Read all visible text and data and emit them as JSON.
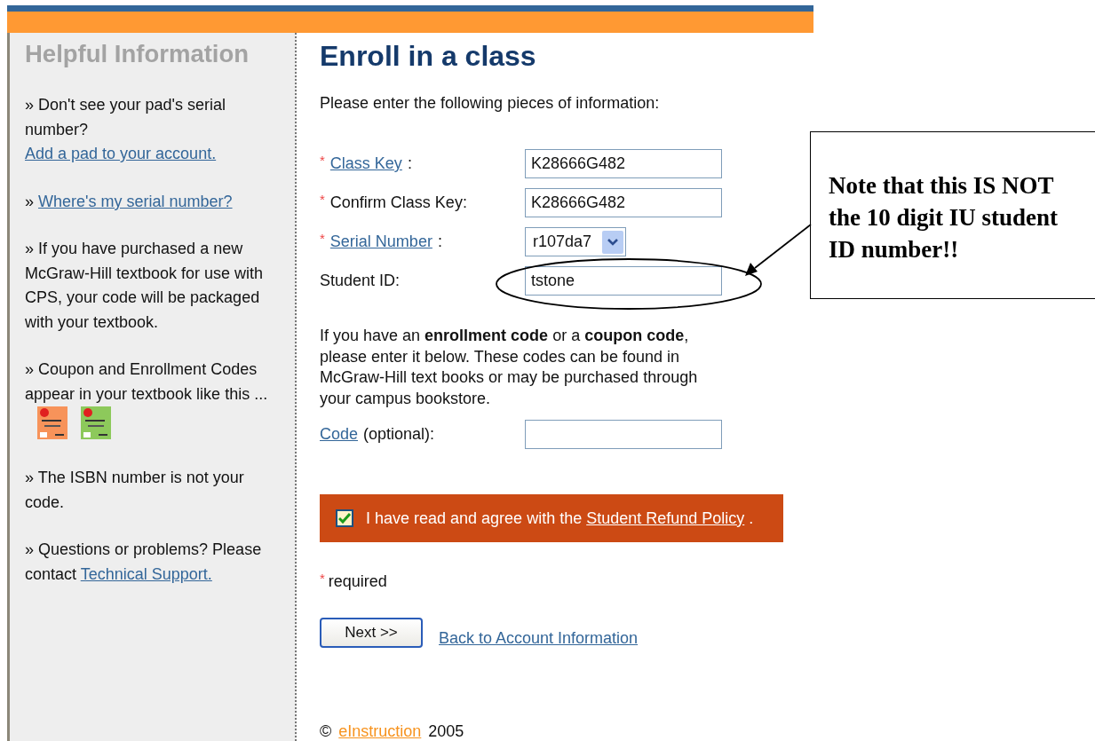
{
  "sidebar": {
    "title": "Helpful Information",
    "items": [
      {
        "text": "» Don't see your pad's serial number?",
        "link": "Add a pad to your account."
      },
      {
        "text": "»",
        "link": "Where's my serial number?"
      },
      {
        "text": "» If you have purchased a new McGraw-Hill textbook for use with CPS, your code will be packaged with your textbook."
      },
      {
        "text": "» Coupon and Enrollment Codes appear in your textbook like this ...",
        "covers": [
          {
            "color": "#f7935a"
          },
          {
            "color": "#8dc95b"
          }
        ]
      },
      {
        "text": "» The ISBN number is not your code."
      },
      {
        "text": "» Questions or problems? Please contact",
        "link": "Technical Support."
      }
    ]
  },
  "main": {
    "title": "Enroll in a class",
    "intro": "Please enter the following pieces of information:",
    "fields": [
      {
        "kind": "text",
        "marker": "*",
        "label": "Class Key",
        "label_is_link": true,
        "suffix": ":",
        "value": "K28666G482"
      },
      {
        "kind": "text",
        "marker": "*",
        "label": "Confirm Class Key:",
        "label_is_link": false,
        "value": "K28666G482"
      },
      {
        "kind": "select",
        "marker": "*",
        "label": "Serial Number",
        "label_is_link": true,
        "suffix": ":",
        "value": "r107da7"
      },
      {
        "kind": "text",
        "label": "Student ID:",
        "label_is_link": false,
        "value": "tstone"
      }
    ],
    "code_note": "If you have an **enrollment code** or a **coupon code**, please enter it below. These codes can be found in McGraw-Hill text books or may be purchased through your campus bookstore.",
    "code_field": {
      "kind": "text",
      "label": "Code",
      "label_is_link": true,
      "suffix": "(optional):"
    },
    "agree": {
      "checked": true,
      "text": "I have read and agree with the",
      "link": "Student Refund Policy",
      "tail": "."
    },
    "required_note": {
      "marker": "*",
      "text": "required"
    },
    "next_button": "Next >>",
    "back_link": "Back to Account Information",
    "footer": {
      "symbol": "©",
      "link": "eInstruction",
      "year": "2005"
    }
  },
  "callout": {
    "text": "Note that this IS NOT the 10 digit IU student ID number!!"
  }
}
